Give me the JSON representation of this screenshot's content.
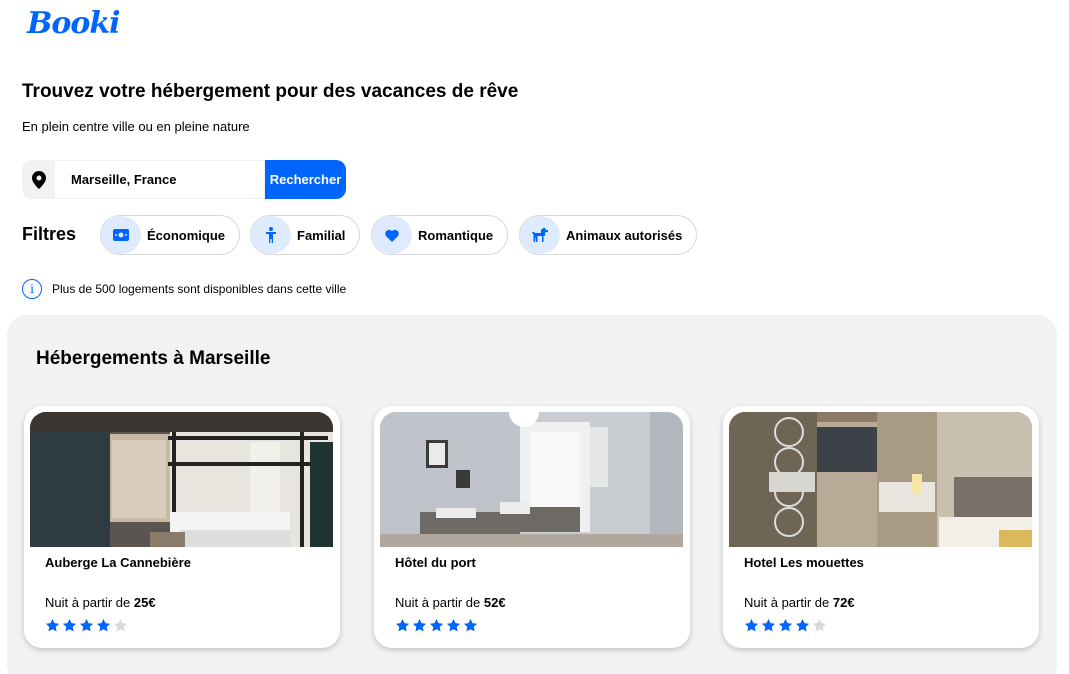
{
  "header": {
    "logo": "Booki"
  },
  "hero": {
    "title": "Trouvez votre hébergement pour des vacances de rêve",
    "subtitle": "En plein centre ville ou en pleine nature"
  },
  "search": {
    "value": "Marseille, France",
    "button_label": "Rechercher",
    "icon": "location-pin-icon"
  },
  "filters": {
    "label": "Filtres",
    "items": [
      {
        "label": "Économique",
        "icon": "money-icon"
      },
      {
        "label": "Familial",
        "icon": "child-icon"
      },
      {
        "label": "Romantique",
        "icon": "heart-icon"
      },
      {
        "label": "Animaux autorisés",
        "icon": "dog-icon"
      }
    ]
  },
  "info": {
    "text": "Plus de 500 logements sont disponibles dans cette ville",
    "icon": "info-icon"
  },
  "listings": {
    "title": "Hébergements à Marseille",
    "price_prefix": "Nuit à partir de",
    "cards": [
      {
        "name": "Auberge La Cannebière",
        "price": "25€",
        "rating": 4
      },
      {
        "name": "Hôtel du port",
        "price": "52€",
        "rating": 5
      },
      {
        "name": "Hotel Les mouettes",
        "price": "72€",
        "rating": 4
      }
    ]
  },
  "colors": {
    "primary": "#0065FC",
    "light_blue": "#DEEBFF",
    "section_bg": "#F2F2F2",
    "star_off": "#D9D9D9"
  }
}
